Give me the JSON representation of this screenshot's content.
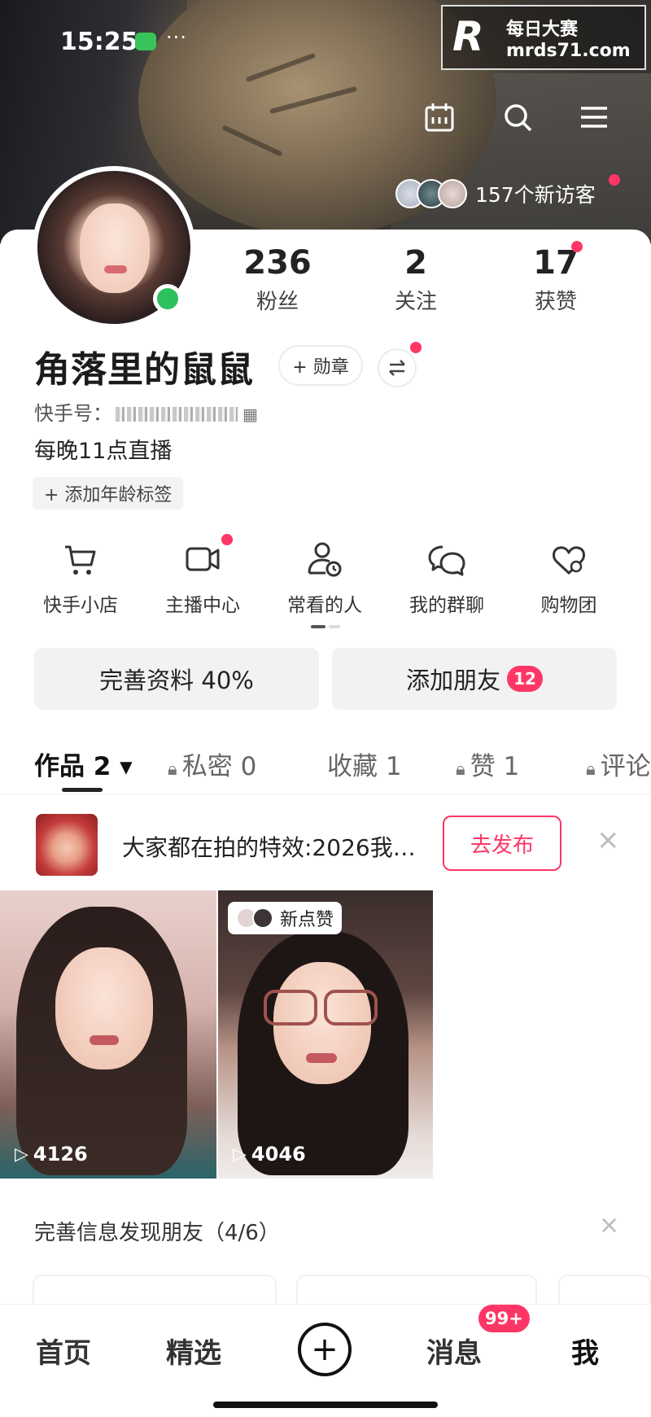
{
  "status": {
    "time": "15:25",
    "dots": "···"
  },
  "watermark": {
    "logo": "R",
    "title": "每日大赛",
    "url": "mrds71.com"
  },
  "header": {
    "visitors_text": "157个新访客"
  },
  "profile": {
    "nickname": "角落里的鼠鼠",
    "badge_button": "+ 勋章",
    "kuaishou_id_label": "快手号：",
    "bio": "每晚11点直播",
    "age_tag": "+ 添加年龄标签",
    "stats": [
      {
        "value": "236",
        "label": "粉丝"
      },
      {
        "value": "2",
        "label": "关注"
      },
      {
        "value": "17",
        "label": "获赞"
      }
    ]
  },
  "quick_actions": [
    {
      "label": "快手小店",
      "icon": "cart-icon"
    },
    {
      "label": "主播中心",
      "icon": "camera-icon"
    },
    {
      "label": "常看的人",
      "icon": "person-clock-icon"
    },
    {
      "label": "我的群聊",
      "icon": "group-chat-icon"
    },
    {
      "label": "购物团",
      "icon": "heart-chat-icon"
    }
  ],
  "buttons": {
    "complete_profile": "完善资料 40%",
    "add_friend": "添加朋友",
    "add_friend_count": "12"
  },
  "tabs": [
    {
      "label": "作品 2 ▾",
      "active": true
    },
    {
      "label": "私密 0",
      "locked": true
    },
    {
      "label": "收藏 1"
    },
    {
      "label": "赞 1",
      "locked": true
    },
    {
      "label": "评论",
      "locked": true
    }
  ],
  "effect": {
    "text": "大家都在拍的特效:2026我…",
    "publish": "去发布"
  },
  "videos": [
    {
      "plays": "4126"
    },
    {
      "plays": "4046",
      "tag": "新点赞"
    }
  ],
  "find_friends": {
    "title": "完善信息发现朋友（4/6）"
  },
  "bottom_nav": {
    "items": [
      "首页",
      "精选",
      "消息",
      "我"
    ],
    "plus": "+",
    "message_badge": "99+"
  },
  "colors": {
    "accent": "#fe3666",
    "online": "#2fc05e"
  }
}
